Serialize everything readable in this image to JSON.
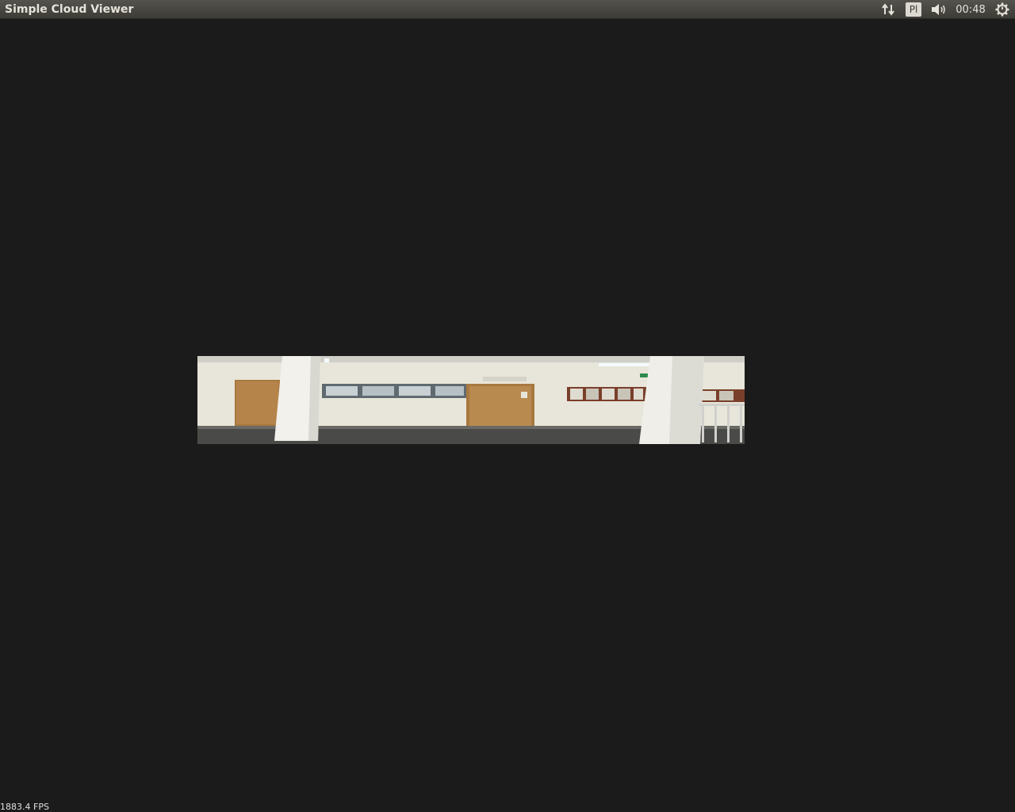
{
  "window": {
    "title": "Simple Cloud Viewer"
  },
  "indicators": {
    "network_icon": "network-updown-icon",
    "keyboard_layout": "Pl",
    "sound_icon": "speaker-volume-icon",
    "clock": "00:48",
    "settings_icon": "gear-power-icon"
  },
  "viewer": {
    "fps_label": "1883.4 FPS",
    "background_color": "#1b1b1b",
    "cloud_content": "point-cloud-corridor-scene"
  },
  "colors": {
    "topbar": "#3d3c37",
    "panel_text": "#e6e3da",
    "viewport": "#1b1b1b"
  }
}
